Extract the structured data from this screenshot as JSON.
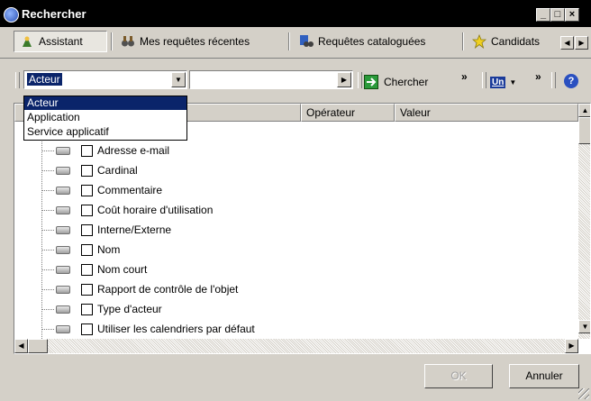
{
  "window": {
    "title": "Rechercher",
    "minimize": "_",
    "maximize": "□",
    "close": "×"
  },
  "tabs": [
    {
      "label": "Assistant",
      "icon": "wizard-icon",
      "active": true
    },
    {
      "label": "Mes requêtes récentes",
      "icon": "binoculars-icon"
    },
    {
      "label": "Requêtes cataloguées",
      "icon": "catalog-binoculars-icon"
    },
    {
      "label": "Candidats",
      "icon": "star-icon"
    }
  ],
  "toolbar": {
    "object_type_value": "Acteur",
    "second_combo_value": "",
    "search_label": "Chercher",
    "more_symbol": "»",
    "options_label": "Un"
  },
  "dropdown": {
    "options": [
      "Acteur",
      "Application",
      "Service applicatif"
    ],
    "highlighted": 0
  },
  "columns": {
    "col1": "",
    "operator": "Opérateur",
    "value": "Valeur"
  },
  "tree_items": [
    "Adresse e-mail",
    "Cardinal",
    "Commentaire",
    "Coût horaire d'utilisation",
    "Interne/Externe",
    "Nom",
    "Nom court",
    "Rapport de contrôle de l'objet",
    "Type d'acteur",
    "Utiliser les calendriers par défaut"
  ],
  "buttons": {
    "ok": "OK",
    "cancel": "Annuler"
  },
  "colors": {
    "selection": "#0a246a",
    "face": "#d4d0c8"
  }
}
